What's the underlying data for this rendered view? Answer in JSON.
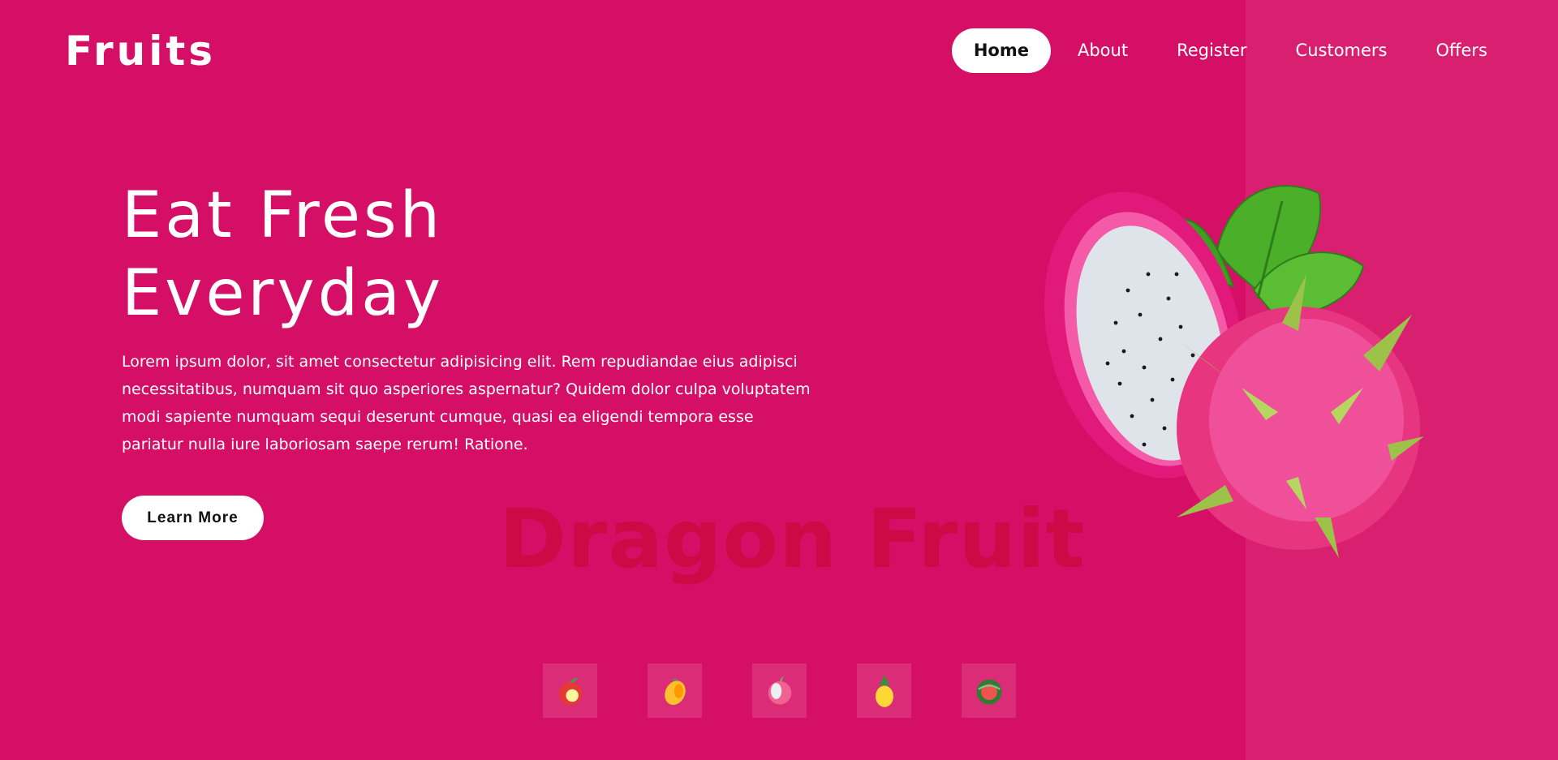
{
  "brand": {
    "logo": "Fruits"
  },
  "nav": {
    "items": [
      {
        "label": "Home",
        "active": true
      },
      {
        "label": "About"
      },
      {
        "label": "Register"
      },
      {
        "label": "Customers"
      },
      {
        "label": "Offers"
      }
    ]
  },
  "hero": {
    "title_line1": "Eat Fresh",
    "title_line2": "Everyday",
    "description": "Lorem ipsum dolor, sit amet consectetur adipisicing elit. Rem repudiandae eius adipisci necessitatibus, numquam sit quo asperiores aspernatur? Quidem dolor culpa voluptatem modi sapiente numquam sequi deserunt cumque, quasi ea eligendi tempora esse pariatur nulla iure laboriosam saepe rerum! Ratione.",
    "cta_label": "Learn More",
    "watermark": "Dragon Fruit",
    "image": "dragon-fruit-image"
  },
  "thumbnails": [
    {
      "icon": "apple-icon"
    },
    {
      "icon": "mango-icon"
    },
    {
      "icon": "dragon-fruit-icon"
    },
    {
      "icon": "pineapple-icon"
    },
    {
      "icon": "watermelon-icon"
    }
  ],
  "colors": {
    "background": "#d60f66",
    "watermark": "#cc0a45",
    "button": "#ffffff"
  }
}
